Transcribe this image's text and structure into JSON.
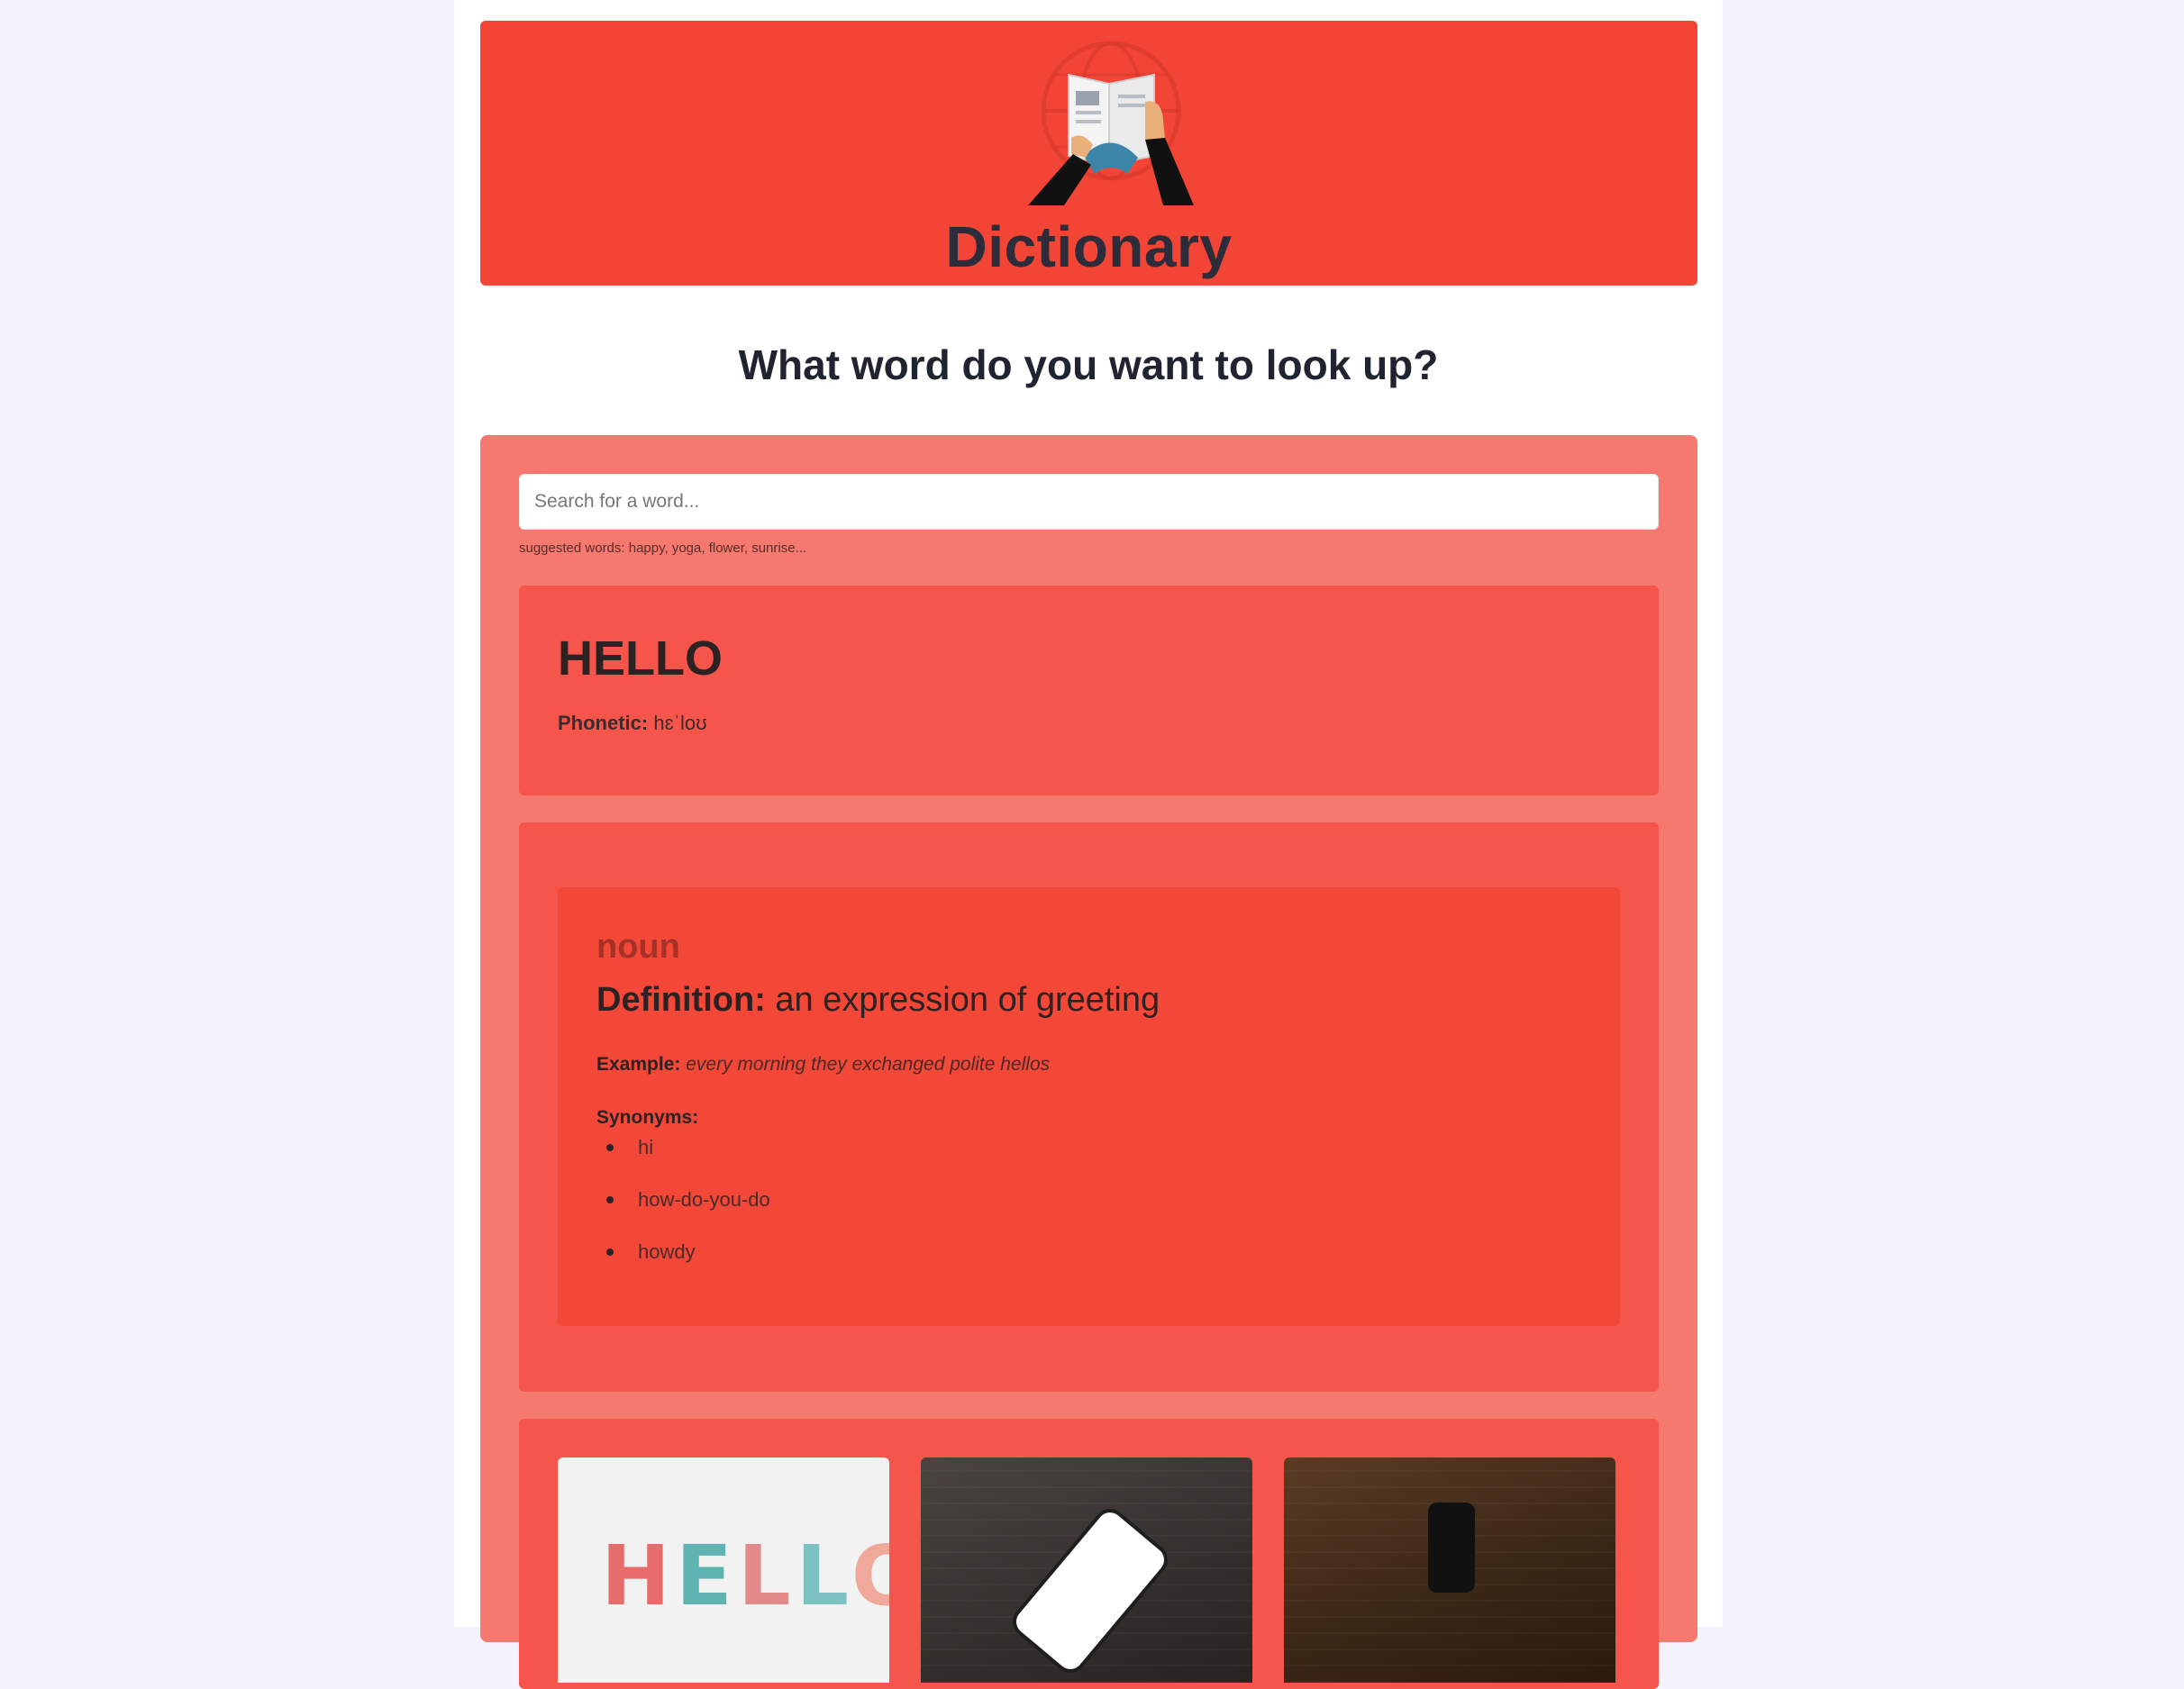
{
  "header": {
    "title": "Dictionary",
    "logo_icon": "dictionary-book-globe-logo"
  },
  "question": "What word do you want to look up?",
  "search": {
    "placeholder": "Search for a word...",
    "value": "",
    "suggested": "suggested words: happy, yoga, flower, sunrise..."
  },
  "word": {
    "title": "HELLO",
    "phonetic_label": "Phonetic:",
    "phonetic_value": "hɛˈloʊ"
  },
  "meaning": {
    "part_of_speech": "noun",
    "definition_label": "Definition:",
    "definition_text": "an expression of greeting",
    "example_label": "Example:",
    "example_text": "every morning they exchanged polite hellos",
    "synonyms_label": "Synonyms:",
    "synonyms": [
      "hi",
      "how-do-you-do",
      "howdy"
    ]
  },
  "photos": [
    {
      "name": "hello-letters-photo",
      "text": "HELLO"
    },
    {
      "name": "phone-on-wood-photo",
      "text": ""
    },
    {
      "name": "dark-phone-on-wood-photo",
      "text": ""
    }
  ],
  "colors": {
    "background": "#f3f1fb",
    "header": "#f24536",
    "panel": "#f67970",
    "card": "#f5554a",
    "inner_card": "#f34738"
  }
}
